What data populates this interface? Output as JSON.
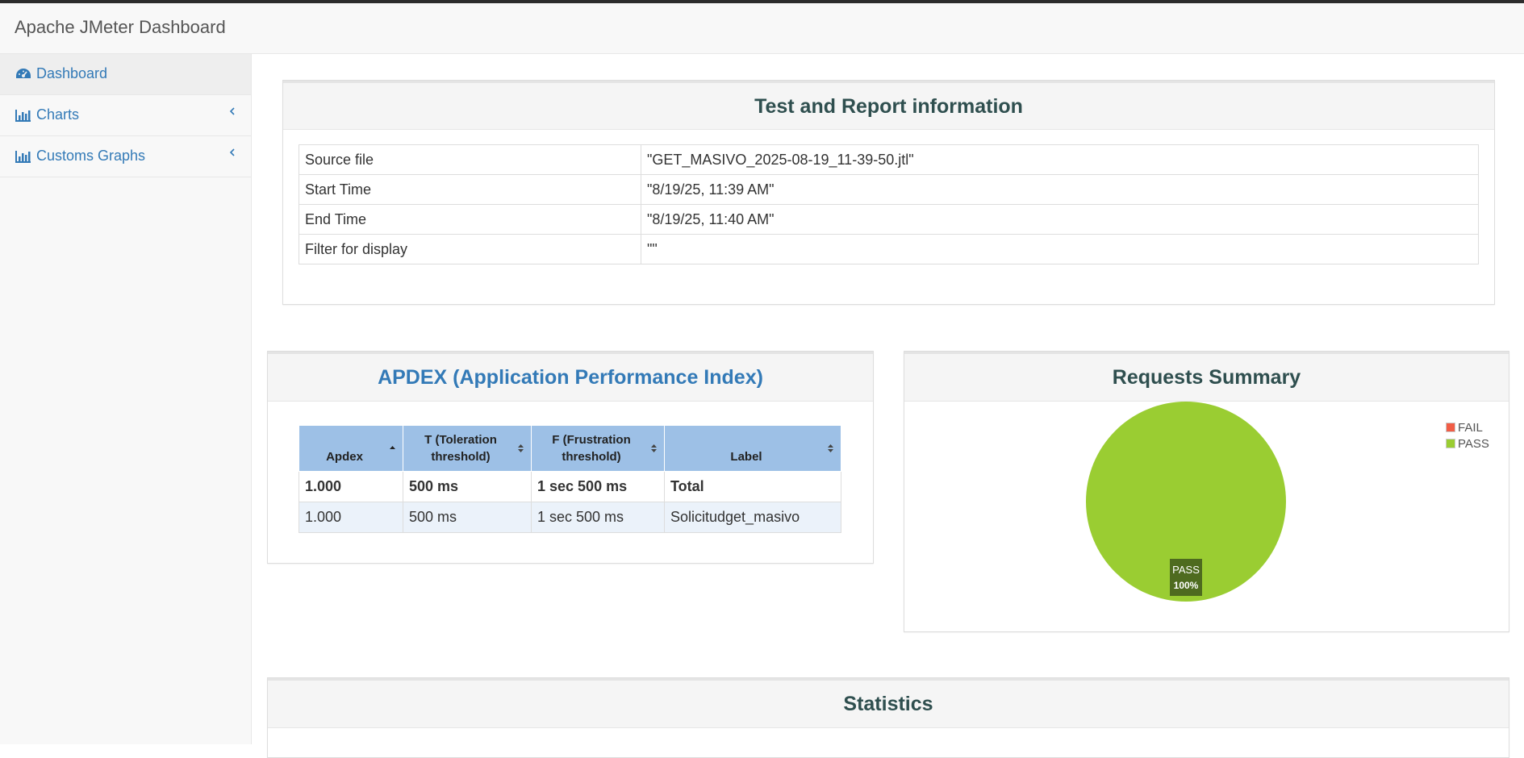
{
  "app": {
    "title": "Apache JMeter Dashboard"
  },
  "sidebar": {
    "items": [
      {
        "label": "Dashboard",
        "icon": "dashboard-icon",
        "active": true
      },
      {
        "label": "Charts",
        "icon": "bar-chart-icon",
        "expandable": true
      },
      {
        "label": "Customs Graphs",
        "icon": "bar-chart-icon",
        "expandable": true
      }
    ]
  },
  "test_info": {
    "title": "Test and Report information",
    "rows": [
      {
        "key": "Source file",
        "value": "\"GET_MASIVO_2025-08-19_11-39-50.jtl\""
      },
      {
        "key": "Start Time",
        "value": "\"8/19/25, 11:39 AM\""
      },
      {
        "key": "End Time",
        "value": "\"8/19/25, 11:40 AM\""
      },
      {
        "key": "Filter for display",
        "value": "\"\""
      }
    ]
  },
  "apdex": {
    "title": "APDEX (Application Performance Index)",
    "headers": [
      "Apdex",
      "T (Toleration threshold)",
      "F (Frustration threshold)",
      "Label"
    ],
    "header_lines": [
      [
        "Apdex"
      ],
      [
        "T (Toleration",
        "threshold)"
      ],
      [
        "F (Frustration",
        "threshold)"
      ],
      [
        "Label"
      ]
    ],
    "rows": [
      [
        "1.000",
        "500 ms",
        "1 sec 500 ms",
        "Total"
      ],
      [
        "1.000",
        "500 ms",
        "1 sec 500 ms",
        "Solicitudget_masivo"
      ]
    ]
  },
  "requests_summary": {
    "title": "Requests Summary",
    "legend": [
      {
        "label": "FAIL",
        "color": "#f15d46"
      },
      {
        "label": "PASS",
        "color": "#9acd32"
      }
    ]
  },
  "chart_data": {
    "type": "pie",
    "categories": [
      "FAIL",
      "PASS"
    ],
    "values": [
      0,
      100
    ],
    "slice_label": "PASS",
    "slice_value_label": "100%",
    "colors": [
      "#f15d46",
      "#9acd32"
    ],
    "legend_position": "top-right"
  },
  "statistics": {
    "title": "Statistics"
  },
  "colors": {
    "link": "#337ab7",
    "heading": "#2f4f4f",
    "apdex_title": "#337ab7",
    "table_header": "#9dc0e6"
  }
}
